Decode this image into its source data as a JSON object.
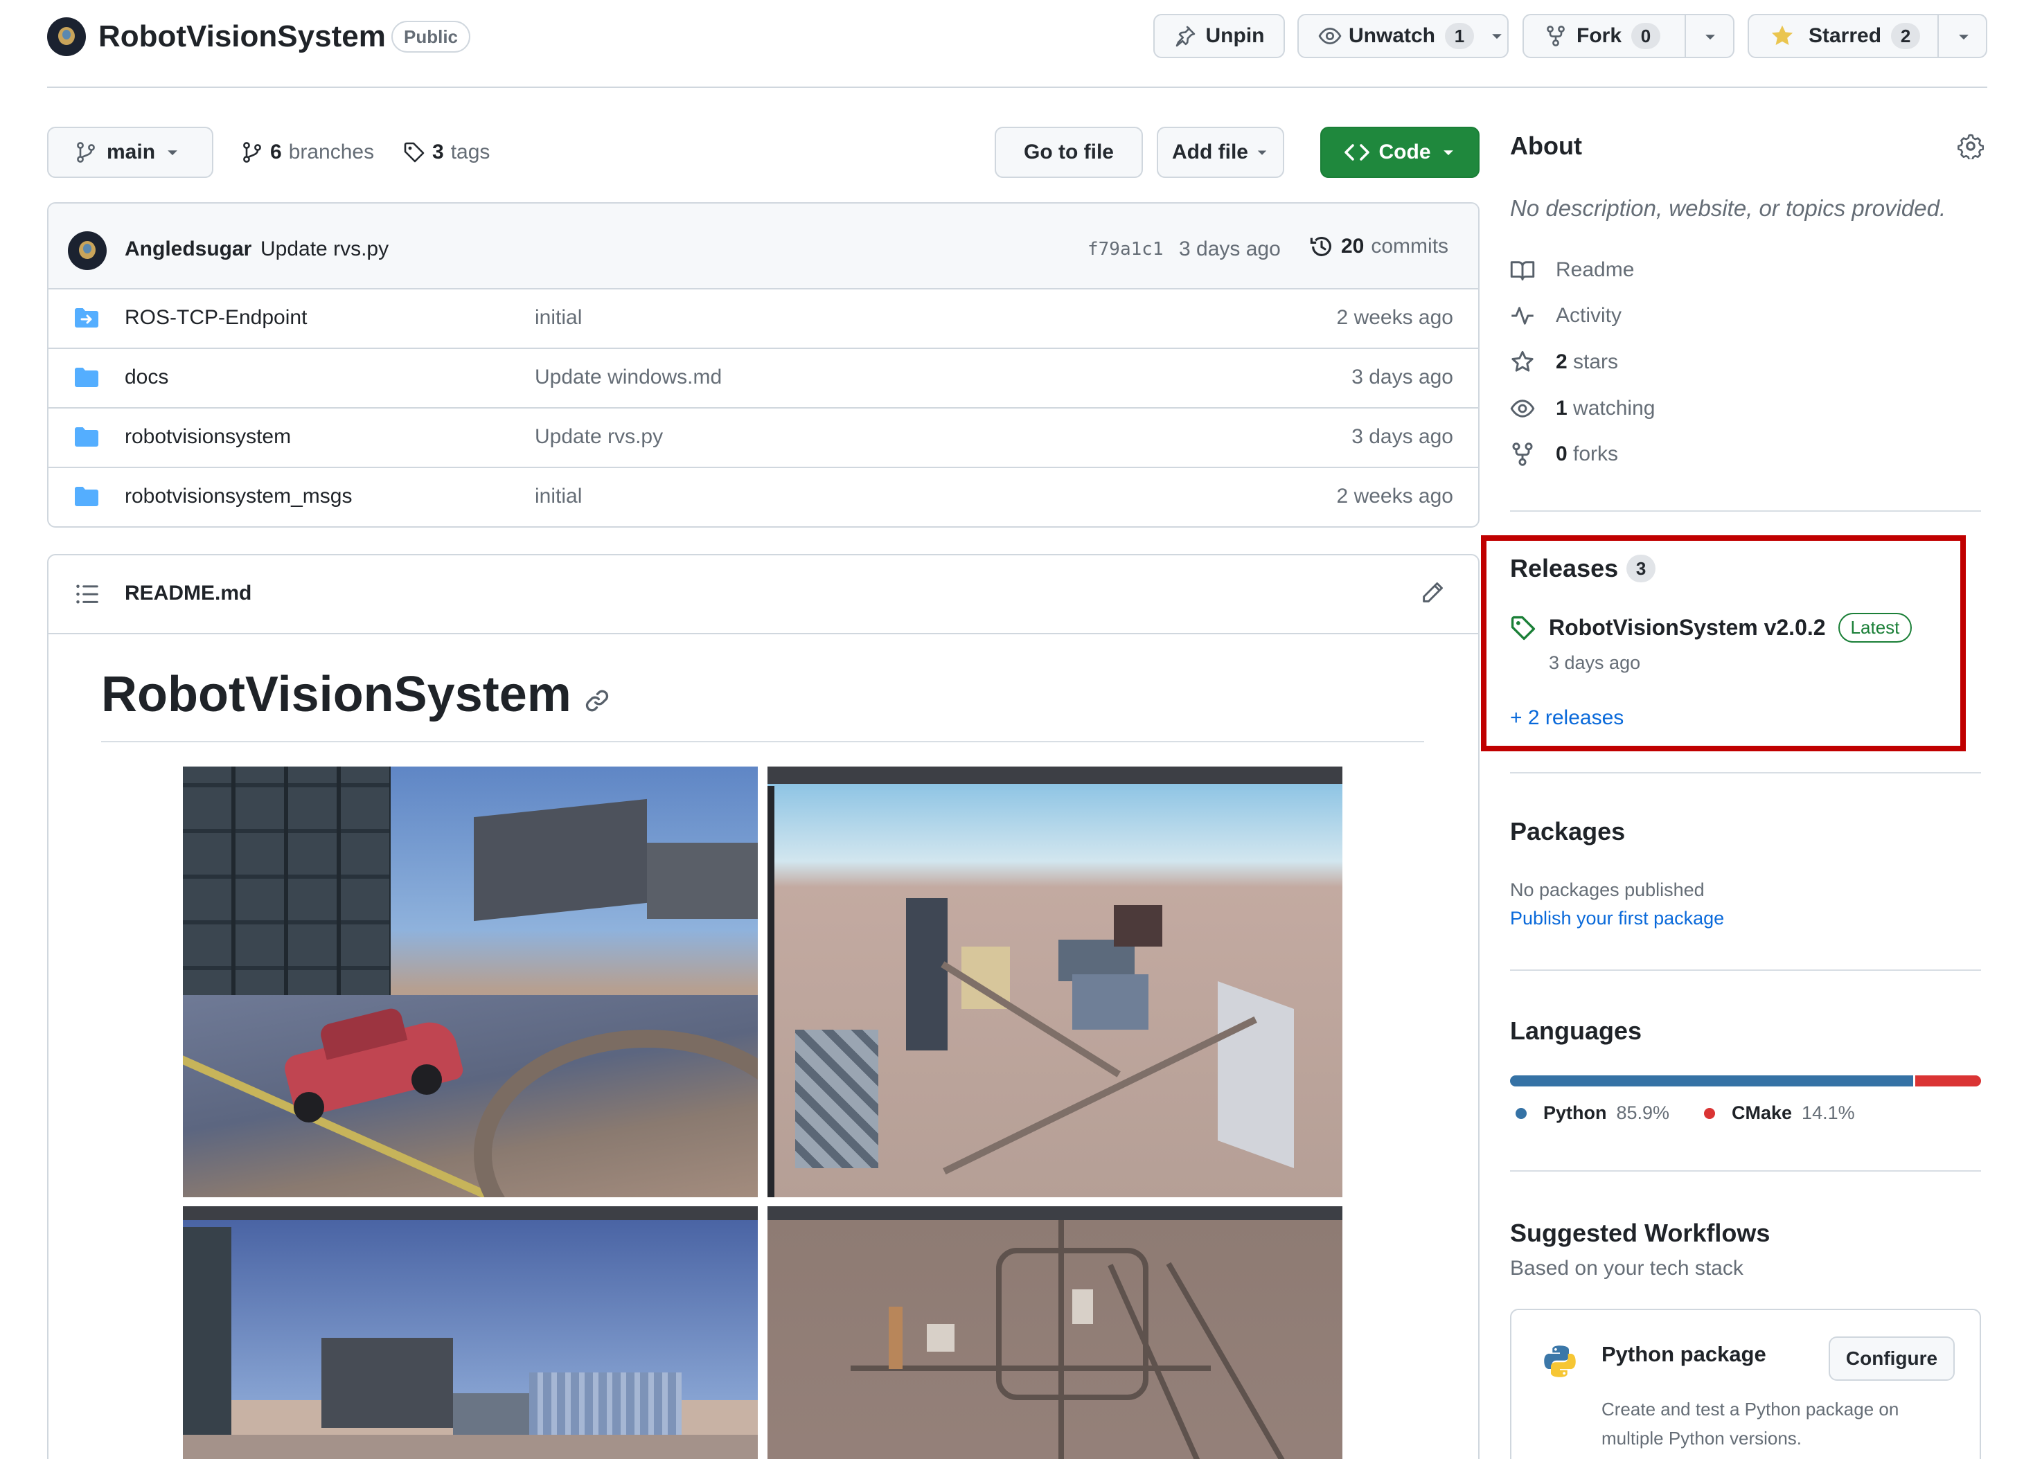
{
  "repo": {
    "name": "RobotVisionSystem",
    "visibility": "Public"
  },
  "header_actions": {
    "unpin_label": "Unpin",
    "unwatch_label": "Unwatch",
    "watch_count": "1",
    "fork_label": "Fork",
    "fork_count": "0",
    "starred_label": "Starred",
    "star_count": "2"
  },
  "toolbar": {
    "branch": "main",
    "branches_count": "6",
    "branches_label": "branches",
    "tags_count": "3",
    "tags_label": "tags",
    "go_to_file": "Go to file",
    "add_file": "Add file",
    "code": "Code"
  },
  "latest_commit": {
    "author": "Angledsugar",
    "message": "Update rvs.py",
    "hash": "f79a1c1",
    "time": "3 days ago",
    "commits_count": "20",
    "commits_label": "commits"
  },
  "files": [
    {
      "name": "ROS-TCP-Endpoint",
      "type": "submodule",
      "message": "initial",
      "time": "2 weeks ago"
    },
    {
      "name": "docs",
      "type": "folder",
      "message": "Update windows.md",
      "time": "3 days ago"
    },
    {
      "name": "robotvisionsystem",
      "type": "folder",
      "message": "Update rvs.py",
      "time": "3 days ago"
    },
    {
      "name": "robotvisionsystem_msgs",
      "type": "folder",
      "message": "initial",
      "time": "2 weeks ago"
    }
  ],
  "readme": {
    "filename": "README.md",
    "heading": "RobotVisionSystem"
  },
  "about": {
    "title": "About",
    "description": "No description, website, or topics provided.",
    "items": [
      {
        "icon": "book-icon",
        "strong": "",
        "text": "Readme"
      },
      {
        "icon": "pulse-icon",
        "strong": "",
        "text": "Activity"
      },
      {
        "icon": "star-icon",
        "strong": "2",
        "text": "stars"
      },
      {
        "icon": "eye-icon",
        "strong": "1",
        "text": "watching"
      },
      {
        "icon": "fork-icon",
        "strong": "0",
        "text": "forks"
      }
    ]
  },
  "releases": {
    "title": "Releases",
    "count": "3",
    "latest_name": "RobotVisionSystem v2.0.2",
    "latest_badge": "Latest",
    "latest_time": "3 days ago",
    "more_link": "+ 2 releases",
    "highlight_color": "#c00000"
  },
  "packages": {
    "title": "Packages",
    "empty_text": "No packages published",
    "publish_link": "Publish your first package"
  },
  "languages": {
    "title": "Languages",
    "items": [
      {
        "name": "Python",
        "percent": "85.9%",
        "share": 85.9,
        "color": "#3572A5"
      },
      {
        "name": "CMake",
        "percent": "14.1%",
        "share": 14.1,
        "color": "#DA3434"
      }
    ]
  },
  "workflows": {
    "title": "Suggested Workflows",
    "subtitle": "Based on your tech stack",
    "card_title": "Python package",
    "card_button": "Configure",
    "card_desc_line1": "Create and test a Python package on",
    "card_desc_line2": "multiple Python versions."
  },
  "colors": {
    "accent_green": "#1f883d",
    "link_blue": "#0969da",
    "folder_blue": "#54aeff"
  }
}
